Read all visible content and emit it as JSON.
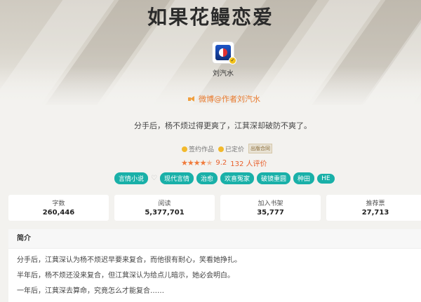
{
  "book": {
    "title": "如果花鳗恋爱",
    "author": "刘汽水",
    "weibo": "微博@作者刘汽水",
    "tagline": "分手后，杨不烦过得更爽了，江萁深却破防不爽了。"
  },
  "badges": {
    "signed": "签约作品",
    "priced": "已定价",
    "publish_tag": "出版合同"
  },
  "rating": {
    "stars": "★★★★",
    "half_star": "★",
    "score": "9.2",
    "reviews": "132 人评价"
  },
  "tags": [
    "言情小说",
    "现代言情",
    "治愈",
    "欢喜冤家",
    "破镜重圆",
    "种田",
    "HE"
  ],
  "stats": [
    {
      "label": "字数",
      "value": "260,446"
    },
    {
      "label": "阅读",
      "value": "5,377,701"
    },
    {
      "label": "加入书架",
      "value": "35,777"
    },
    {
      "label": "推荐票",
      "value": "27,713"
    }
  ],
  "intro": {
    "heading": "简介",
    "lines": [
      "分手后，江萁深认为杨不烦迟早要来复合，而他很有耐心，笑看她挣扎。",
      "半年后，杨不烦还没来复合，但江萁深认为给点儿暗示，她必会明白。",
      "一年后，江萁深去算命，究竟怎么才能复合……"
    ]
  },
  "colors": {
    "accent_teal": "#19b0a8",
    "accent_orange": "#e87a2d",
    "star": "#f07a3a"
  },
  "icons": [
    "pepsi-avatar-icon",
    "verified-icon",
    "speaker-icon",
    "heart-icon",
    "star-icon"
  ]
}
